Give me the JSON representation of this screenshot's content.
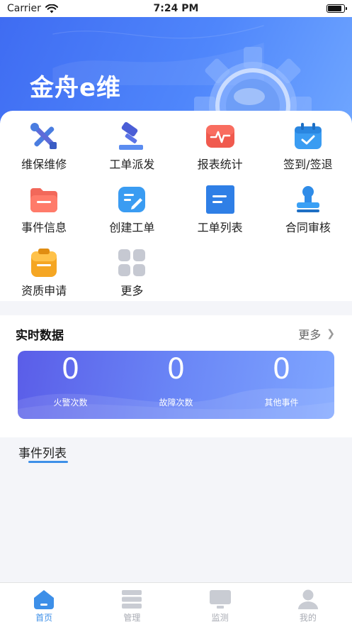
{
  "status_bar": {
    "carrier": "Carrier",
    "time": "7:24 PM",
    "battery_level": 0.85
  },
  "banner": {
    "title": "金舟e维"
  },
  "menu": {
    "items": [
      {
        "label": "维保维修",
        "icon": "tools-icon"
      },
      {
        "label": "工单派发",
        "icon": "gavel-icon"
      },
      {
        "label": "报表统计",
        "icon": "pulse-chart-icon"
      },
      {
        "label": "签到/签退",
        "icon": "calendar-check-icon"
      },
      {
        "label": "事件信息",
        "icon": "folder-icon"
      },
      {
        "label": "创建工单",
        "icon": "edit-note-icon"
      },
      {
        "label": "工单列表",
        "icon": "list-document-icon"
      },
      {
        "label": "合同审核",
        "icon": "stamp-icon"
      },
      {
        "label": "资质申请",
        "icon": "clipboard-icon"
      },
      {
        "label": "更多",
        "icon": "grid-more-icon"
      }
    ]
  },
  "realtime": {
    "title": "实时数据",
    "more_label": "更多",
    "stats": [
      {
        "value": "0",
        "label": "火警次数"
      },
      {
        "value": "0",
        "label": "故障次数"
      },
      {
        "value": "0",
        "label": "其他事件"
      }
    ]
  },
  "events": {
    "tab_label": "事件列表"
  },
  "tab_bar": {
    "tabs": [
      {
        "label": "首页",
        "icon": "home-icon",
        "active": true
      },
      {
        "label": "管理",
        "icon": "server-icon",
        "active": false
      },
      {
        "label": "监测",
        "icon": "monitor-icon",
        "active": false
      },
      {
        "label": "我的",
        "icon": "user-icon",
        "active": false
      }
    ]
  },
  "colors": {
    "primary": "#3f6cf2",
    "active_tab": "#3d8fe8",
    "inactive_tab": "#c9ccd3"
  }
}
